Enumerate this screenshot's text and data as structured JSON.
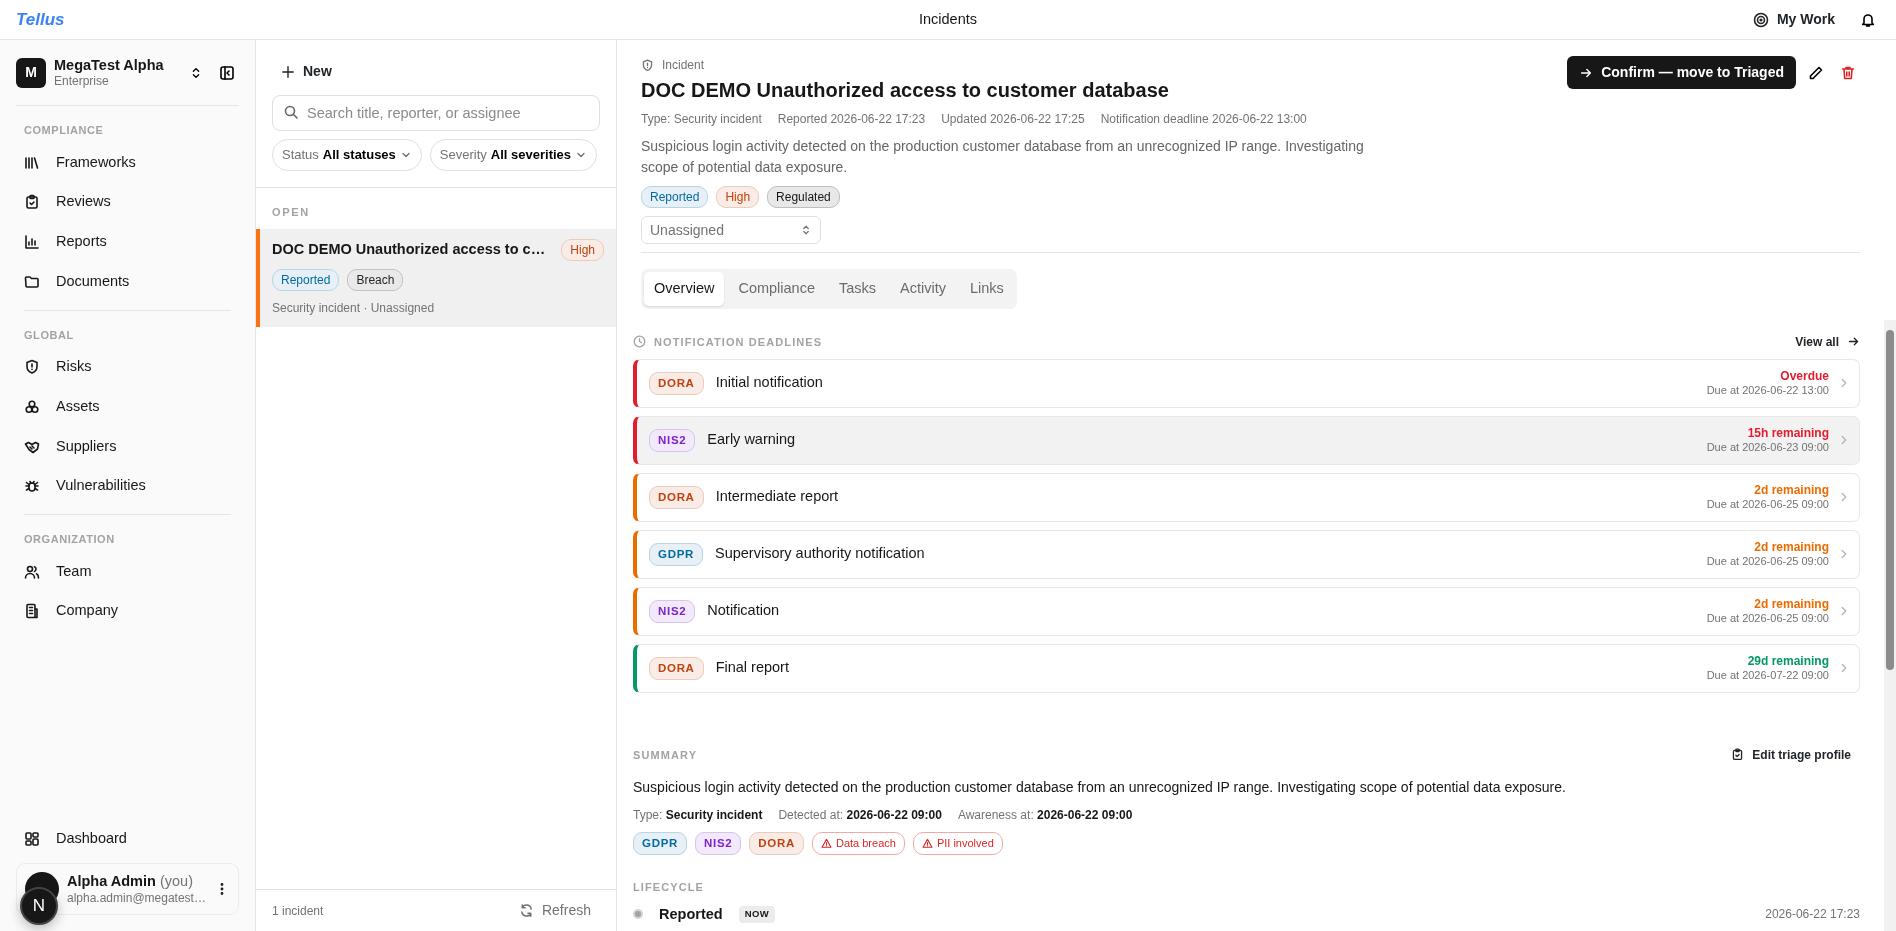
{
  "app": {
    "logo": "Tellus",
    "title": "Incidents",
    "my_work": "My Work"
  },
  "org": {
    "initial": "M",
    "name": "MegaTest Alpha",
    "plan": "Enterprise"
  },
  "sidebar": {
    "sections": [
      {
        "label": "COMPLIANCE",
        "items": [
          {
            "label": "Frameworks"
          },
          {
            "label": "Reviews"
          },
          {
            "label": "Reports"
          },
          {
            "label": "Documents"
          }
        ]
      },
      {
        "label": "GLOBAL",
        "items": [
          {
            "label": "Risks"
          },
          {
            "label": "Assets"
          },
          {
            "label": "Suppliers"
          },
          {
            "label": "Vulnerabilities"
          }
        ]
      },
      {
        "label": "ORGANIZATION",
        "items": [
          {
            "label": "Team"
          },
          {
            "label": "Company"
          }
        ]
      }
    ],
    "bottom_item": {
      "label": "Dashboard"
    }
  },
  "user": {
    "name": "Alpha Admin",
    "suffix": "(you)",
    "email": "alpha.admin@megatest…"
  },
  "dev_badge": "N",
  "list": {
    "new_label": "New",
    "search": {
      "placeholder": "Search title, reporter, or assignee"
    },
    "filters": [
      {
        "label": "Status",
        "value": "All statuses"
      },
      {
        "label": "Severity",
        "value": "All severities"
      }
    ],
    "group": "OPEN",
    "incidents": [
      {
        "title": "DOC DEMO Unauthorized access to c…",
        "severity": {
          "label": "High",
          "color": "#c2410c"
        },
        "tags": [
          {
            "label": "Reported",
            "color": "#0369a1"
          },
          {
            "label": "Breach",
            "color": "#262626"
          }
        ],
        "meta": "Security incident · Unassigned",
        "selected": true
      }
    ],
    "count": "1 incident",
    "refresh": "Refresh"
  },
  "detail": {
    "kicker": "Incident",
    "title": "DOC DEMO Unauthorized access to customer database",
    "meta": [
      "Type: Security incident",
      "Reported 2026-06-22 17:23",
      "Updated 2026-06-22 17:25",
      "Notification deadline 2026-06-22 13:00"
    ],
    "description": "Suspicious login activity detected on the production customer database from an unrecognized IP range. Investigating scope of potential data exposure.",
    "badges": [
      {
        "label": "Reported",
        "color": "#0369a1"
      },
      {
        "label": "High",
        "color": "#c2410c"
      },
      {
        "label": "Regulated",
        "color": "#171717"
      }
    ],
    "assignee": {
      "value": "Unassigned"
    },
    "primary_action": "Confirm — move to Triaged",
    "tabs": [
      {
        "label": "Overview",
        "selected": true
      },
      {
        "label": "Compliance",
        "selected": false
      },
      {
        "label": "Tasks",
        "selected": false
      },
      {
        "label": "Activity",
        "selected": false
      },
      {
        "label": "Links",
        "selected": false
      }
    ],
    "deadlines": {
      "heading": "NOTIFICATION DEADLINES",
      "view_all": "View all",
      "items": [
        {
          "framework": {
            "label": "DORA",
            "color": "#c2410c"
          },
          "title": "Initial notification",
          "remaining": "Overdue",
          "due": "Due at 2026-06-22 13:00",
          "color": "#e11d2e",
          "highlighted": false
        },
        {
          "framework": {
            "label": "NIS2",
            "color": "#7e22ce"
          },
          "title": "Early warning",
          "remaining": "15h remaining",
          "due": "Due at 2026-06-23 09:00",
          "color": "#e11d2e",
          "highlighted": true
        },
        {
          "framework": {
            "label": "DORA",
            "color": "#c2410c"
          },
          "title": "Intermediate report",
          "remaining": "2d remaining",
          "due": "Due at 2026-06-25 09:00",
          "color": "#ea6c00",
          "highlighted": false
        },
        {
          "framework": {
            "label": "GDPR",
            "color": "#0369a1"
          },
          "title": "Supervisory authority notification",
          "remaining": "2d remaining",
          "due": "Due at 2026-06-25 09:00",
          "color": "#ea6c00",
          "highlighted": false
        },
        {
          "framework": {
            "label": "NIS2",
            "color": "#7e22ce"
          },
          "title": "Notification",
          "remaining": "2d remaining",
          "due": "Due at 2026-06-25 09:00",
          "color": "#ea6c00",
          "highlighted": false
        },
        {
          "framework": {
            "label": "DORA",
            "color": "#c2410c"
          },
          "title": "Final report",
          "remaining": "29d remaining",
          "due": "Due at 2026-07-22 09:00",
          "color": "#059669",
          "highlighted": false
        }
      ]
    },
    "summary": {
      "heading": "SUMMARY",
      "edit": "Edit triage profile",
      "text": "Suspicious login activity detected on the production customer database from an unrecognized IP range. Investigating scope of potential data exposure.",
      "facts": [
        {
          "label": "Type:",
          "value": "Security incident"
        },
        {
          "label": "Detected at:",
          "value": "2026-06-22 09:00"
        },
        {
          "label": "Awareness at:",
          "value": "2026-06-22 09:00"
        }
      ],
      "tags": [
        {
          "label": "GDPR",
          "color": "#0369a1",
          "kind": "framework"
        },
        {
          "label": "NIS2",
          "color": "#7e22ce",
          "kind": "framework"
        },
        {
          "label": "DORA",
          "color": "#c2410c",
          "kind": "framework"
        },
        {
          "label": "Data breach",
          "color": "#dc2626",
          "kind": "flag"
        },
        {
          "label": "PII involved",
          "color": "#dc2626",
          "kind": "flag"
        }
      ]
    },
    "lifecycle": {
      "heading": "LIFECYCLE",
      "steps": [
        {
          "label": "Reported",
          "badge": "NOW",
          "time": "2026-06-22 17:23"
        }
      ]
    }
  }
}
